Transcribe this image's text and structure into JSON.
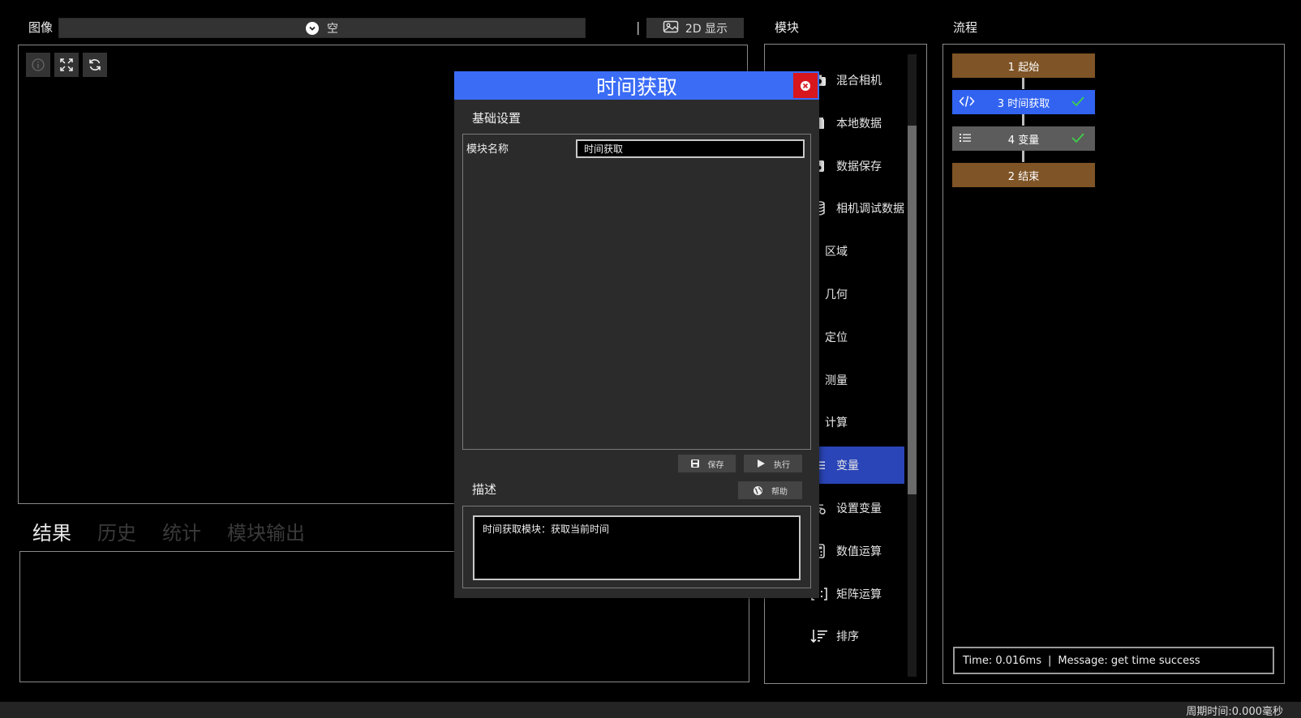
{
  "image_panel": {
    "label": "图像",
    "source_value": "空",
    "display_button": "2D 显示",
    "separator": "|"
  },
  "result_tabs": [
    {
      "label": "结果",
      "active": true
    },
    {
      "label": "历史",
      "active": false
    },
    {
      "label": "统计",
      "active": false
    },
    {
      "label": "模块输出",
      "active": false
    }
  ],
  "modules": {
    "title": "模块",
    "items": [
      {
        "label": "混合相机",
        "icon": "camera-icon"
      },
      {
        "label": "本地数据",
        "icon": "folder-icon"
      },
      {
        "label": "数据保存",
        "icon": "save-icon"
      },
      {
        "label": "相机调试数据",
        "icon": "database-icon"
      },
      {
        "label": "区域",
        "icon": "region-icon"
      },
      {
        "label": "几何",
        "icon": "geometry-icon"
      },
      {
        "label": "定位",
        "icon": "locate-icon"
      },
      {
        "label": "测量",
        "icon": "measure-icon"
      },
      {
        "label": "计算",
        "icon": "calc-icon"
      },
      {
        "label": "变量",
        "icon": "list-icon",
        "active": true
      },
      {
        "label": "设置变量",
        "icon": "set-var-icon"
      },
      {
        "label": "数值运算",
        "icon": "calculator-icon"
      },
      {
        "label": "矩阵运算",
        "icon": "matrix-icon"
      },
      {
        "label": "排序",
        "icon": "sort-icon"
      }
    ]
  },
  "flow": {
    "title": "流程",
    "nodes": [
      {
        "label": "1 起始",
        "color": "#7f5426"
      },
      {
        "label": "3 时间获取",
        "color": "#3163f0",
        "status": "check"
      },
      {
        "label": "4 变量",
        "color": "#5c5c5c",
        "status": "check"
      },
      {
        "label": "2 结束",
        "color": "#7f5426"
      }
    ],
    "status_time": "Time: 0.016ms",
    "status_sep": "|",
    "status_message": "Message: get time success"
  },
  "dialog": {
    "title": "时间获取",
    "basic_settings": "基础设置",
    "module_name_label": "模块名称",
    "module_name_value": "时间获取",
    "save_button": "保存",
    "execute_button": "执行",
    "description_title": "描述",
    "help_button": "帮助",
    "description_text": "时间获取模块：获取当前时间"
  },
  "footer": {
    "cycle_time": "周期时间:0.000毫秒"
  },
  "colors": {
    "accent_blue": "#3b6cf6",
    "active_module": "#2a45b8",
    "flow_brown": "#7f5426",
    "check_green": "#3fcf4a",
    "close_red": "#d7161e"
  }
}
